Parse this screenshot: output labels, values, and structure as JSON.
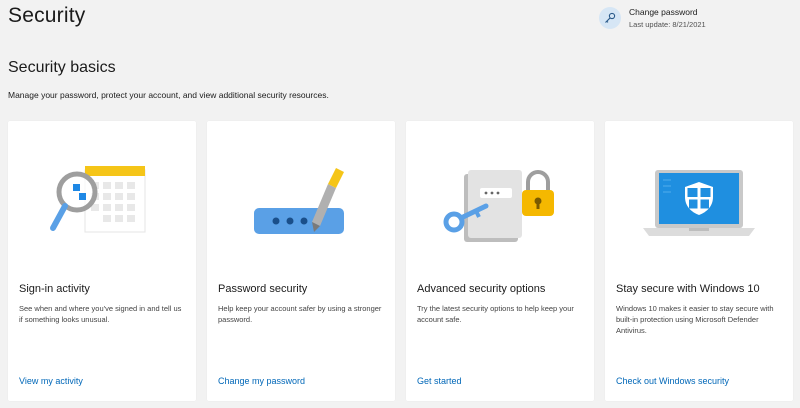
{
  "header": {
    "title": "Security",
    "password_panel": {
      "title": "Change password",
      "last_update": "Last update: 8/21/2021",
      "icon": "key-icon"
    }
  },
  "section": {
    "title": "Security basics",
    "description": "Manage your password, protect your account, and view additional security resources."
  },
  "cards": [
    {
      "illustration": "magnifier-calendar-illustration",
      "title": "Sign-in activity",
      "description": "See when and where you've signed in and tell us if something looks unusual.",
      "link": "View my activity"
    },
    {
      "illustration": "pen-password-field-illustration",
      "title": "Password security",
      "description": "Help keep your account safer by using a stronger password.",
      "link": "Change my password"
    },
    {
      "illustration": "key-lock-document-illustration",
      "title": "Advanced security options",
      "description": "Try the latest security options to help keep your account safe.",
      "link": "Get started"
    },
    {
      "illustration": "laptop-shield-illustration",
      "title": "Stay secure with Windows 10",
      "description": "Windows 10 makes it easier to stay secure with built-in protection using Microsoft Defender Antivirus.",
      "link": "Check out Windows security"
    }
  ],
  "colors": {
    "link": "#0067b8",
    "background": "#f2f2f2",
    "card": "#ffffff"
  }
}
